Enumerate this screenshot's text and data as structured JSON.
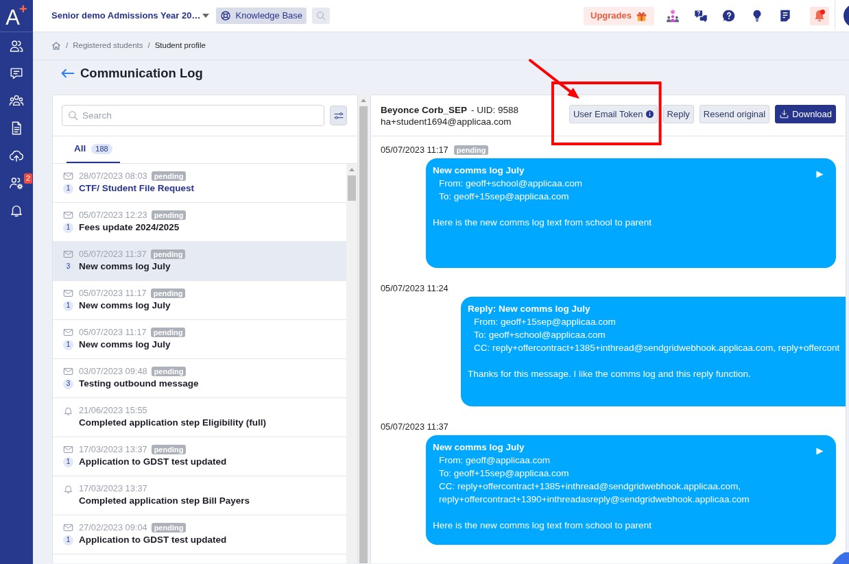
{
  "sidebar": {
    "logo": {
      "letter": "A",
      "mark": "+"
    },
    "items": [
      {
        "kind": "contacts"
      },
      {
        "kind": "messages"
      },
      {
        "kind": "groups"
      },
      {
        "kind": "documents"
      },
      {
        "kind": "upload"
      },
      {
        "kind": "user_settings",
        "badge": "2"
      },
      {
        "kind": "notifications"
      }
    ]
  },
  "top_bar": {
    "workspace": "Senior demo Admissions Year 20…",
    "knowledge_base": "Knowledge Base",
    "upgrades": "Upgrades",
    "tools": [
      {
        "kind": "ideas",
        "alert": false
      },
      {
        "kind": "support_chat",
        "alert": false
      },
      {
        "kind": "help",
        "alert": false
      },
      {
        "kind": "tips",
        "alert": false
      },
      {
        "kind": "notes",
        "alert": false
      },
      {
        "kind": "notifications",
        "alert": true
      }
    ]
  },
  "breadcrumb": [
    {
      "separator": "/",
      "label": "Registered students",
      "current": false
    },
    {
      "separator": "/",
      "label": "Student profile",
      "current": true
    }
  ],
  "page_title": "Communication Log",
  "log_list": {
    "search": {
      "placeholder": "Search"
    },
    "tabs": [
      {
        "label": "All",
        "count": "188",
        "selected": true
      }
    ],
    "items": [
      {
        "kind": "email",
        "date": "28/07/2023 08:03",
        "status": "pending",
        "count": "1",
        "title": "CTF/ Student File Request",
        "unread": true,
        "selected": false
      },
      {
        "kind": "email",
        "date": "05/07/2023 12:23",
        "status": "pending",
        "count": "1",
        "title": "Fees update 2024/2025",
        "unread": false,
        "selected": false
      },
      {
        "kind": "email",
        "date": "05/07/2023 11:37",
        "status": "pending",
        "count": "3",
        "title": "New comms log July",
        "unread": false,
        "selected": true
      },
      {
        "kind": "email",
        "date": "05/07/2023 11:17",
        "status": "pending",
        "count": "1",
        "title": "New comms log July",
        "unread": false,
        "selected": false
      },
      {
        "kind": "email",
        "date": "05/07/2023 11:17",
        "status": "pending",
        "count": "1",
        "title": "New comms log July",
        "unread": false,
        "selected": false
      },
      {
        "kind": "email",
        "date": "03/07/2023 09:48",
        "status": "pending",
        "count": "3",
        "title": "Testing outbound message",
        "unread": false,
        "selected": false
      },
      {
        "kind": "notification",
        "date": "21/06/2023 15:55",
        "title": "Completed application step Eligibility (full)",
        "unread": false,
        "selected": false
      },
      {
        "kind": "email",
        "date": "17/03/2023 13:37",
        "status": "pending",
        "count": "1",
        "title": "Application to GDST test updated",
        "unread": false,
        "selected": false
      },
      {
        "kind": "notification",
        "date": "17/03/2023 13:37",
        "title": "Completed application step Bill Payers",
        "unread": false,
        "selected": false
      },
      {
        "kind": "email",
        "date": "27/02/2023 09:04",
        "status": "pending",
        "count": "1",
        "title": "Application to GDST test updated",
        "unread": false,
        "selected": false
      }
    ]
  },
  "conversation": {
    "student": "Beyonce Corb_SEP",
    "uid": "- UID: 9588",
    "email": "ha+student1694@applicaa.com",
    "buttons": [
      {
        "label": "User Email Token",
        "kind": "token"
      },
      {
        "label": "Reply",
        "kind": "secondary"
      },
      {
        "label": "Resend original",
        "kind": "secondary"
      },
      {
        "label": "Download",
        "kind": "primary"
      }
    ],
    "messages": [
      {
        "kind": "sent",
        "date": "05/07/2023 11:17",
        "status": "pending",
        "subject": "New comms log July",
        "headers": [
          "From: geoff+school@applicaa.com",
          "To: geoff+15sep@applicaa.com"
        ],
        "body": "Here is the new comms log text from school to parent",
        "toggle": true
      },
      {
        "kind": "reply",
        "date": "05/07/2023 11:24",
        "subject": "Reply: New comms log July",
        "headers": [
          "From: geoff+15sep@applicaa.com",
          "To: geoff+school@applicaa.com",
          "CC: reply+offercontract+1385+inthread@sendgridwebhook.applicaa.com, reply+offercont"
        ],
        "body": "Thanks for this message. I like the comms log and this reply function.",
        "toggle": false
      },
      {
        "kind": "sent",
        "date": "05/07/2023 11:37",
        "subject": "New comms log July",
        "headers": [
          "From: geoff@applicaa.com",
          "To: geoff+15sep@applicaa.com",
          "CC: reply+offercontract+1385+inthread@sendgridwebhook.applicaa.com, reply+offercontract+1390+inthreadasreply@sendgridwebhook.applicaa.com"
        ],
        "body": "Here is the new comms log text from school to parent",
        "toggle": true
      }
    ]
  },
  "annotations": {
    "arrow": true,
    "highlight_box": true
  }
}
